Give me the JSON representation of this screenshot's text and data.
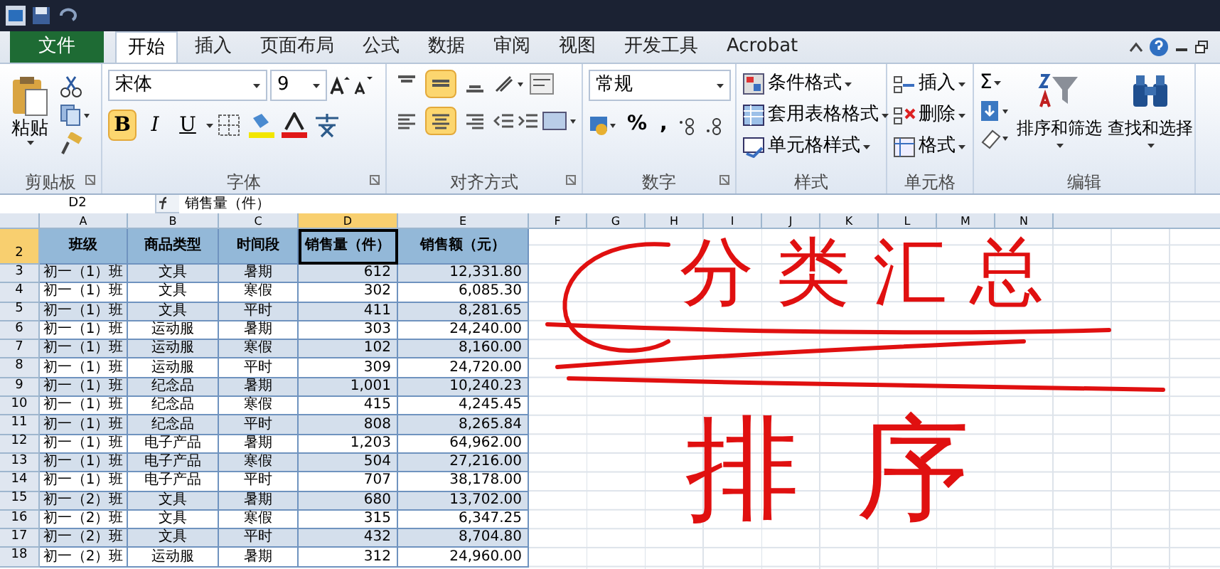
{
  "tabs": [
    {
      "label": "文件",
      "kind": "file",
      "selected": false
    },
    {
      "label": "开始",
      "kind": "tab",
      "selected": true
    },
    {
      "label": "插入",
      "kind": "tab",
      "selected": false
    },
    {
      "label": "页面布局",
      "kind": "tab",
      "selected": false
    },
    {
      "label": "公式",
      "kind": "tab",
      "selected": false
    },
    {
      "label": "数据",
      "kind": "tab",
      "selected": false
    },
    {
      "label": "审阅",
      "kind": "tab",
      "selected": false
    },
    {
      "label": "视图",
      "kind": "tab",
      "selected": false
    },
    {
      "label": "开发工具",
      "kind": "tab",
      "selected": false
    },
    {
      "label": "Acrobat",
      "kind": "tab",
      "selected": false
    }
  ],
  "ribbon": {
    "clipboard": {
      "label": "剪贴板",
      "paste": "粘贴"
    },
    "font": {
      "label": "字体",
      "font_name": "宋体",
      "font_size": "9",
      "toggles": [
        {
          "label": "B",
          "selected": true
        },
        {
          "label": "I",
          "selected": false
        },
        {
          "label": "U",
          "selected": false
        }
      ]
    },
    "alignment": {
      "label": "对齐方式",
      "vertical": [
        {
          "selected": false
        },
        {
          "selected": true
        },
        {
          "selected": false
        }
      ],
      "horizontal": [
        {
          "selected": false
        },
        {
          "selected": true
        },
        {
          "selected": false
        }
      ]
    },
    "number": {
      "label": "数字",
      "format": "常规",
      "symbols": [
        "%",
        ","
      ]
    },
    "styles": {
      "label": "样式",
      "items": [
        "条件格式",
        "套用表格格式",
        "单元格样式"
      ]
    },
    "cells": {
      "label": "单元格",
      "items": [
        "插入",
        "删除",
        "格式"
      ]
    },
    "editing": {
      "label": "编辑",
      "sigma": "Σ",
      "items": [
        "排序和筛选",
        "查找和选择"
      ]
    }
  },
  "formula_bar": {
    "name_box": "D2",
    "formula": "销售量（件）"
  },
  "columns": [
    {
      "label": "A",
      "selected": false
    },
    {
      "label": "B",
      "selected": false
    },
    {
      "label": "C",
      "selected": false
    },
    {
      "label": "D",
      "selected": true
    },
    {
      "label": "E",
      "selected": false
    },
    {
      "label": "F",
      "selected": false
    },
    {
      "label": "G",
      "selected": false
    },
    {
      "label": "H",
      "selected": false
    },
    {
      "label": "I",
      "selected": false
    },
    {
      "label": "J",
      "selected": false
    },
    {
      "label": "K",
      "selected": false
    },
    {
      "label": "L",
      "selected": false
    },
    {
      "label": "M",
      "selected": false
    },
    {
      "label": "N",
      "selected": false
    }
  ],
  "rows": [
    {
      "number": "2",
      "selected": true,
      "kind": "header",
      "cells": [
        "班级",
        "商品类型",
        "时间段",
        "销售量（件）",
        "销售额（元）"
      ]
    },
    {
      "number": "3",
      "selected": false,
      "kind": "data",
      "cells": [
        "初一（1）班",
        "文具",
        "暑期",
        "612",
        "12,331.80"
      ]
    },
    {
      "number": "4",
      "selected": false,
      "kind": "data",
      "cells": [
        "初一（1）班",
        "文具",
        "寒假",
        "302",
        "6,085.30"
      ]
    },
    {
      "number": "5",
      "selected": false,
      "kind": "data",
      "cells": [
        "初一（1）班",
        "文具",
        "平时",
        "411",
        "8,281.65"
      ]
    },
    {
      "number": "6",
      "selected": false,
      "kind": "data",
      "cells": [
        "初一（1）班",
        "运动服",
        "暑期",
        "303",
        "24,240.00"
      ]
    },
    {
      "number": "7",
      "selected": false,
      "kind": "data",
      "cells": [
        "初一（1）班",
        "运动服",
        "寒假",
        "102",
        "8,160.00"
      ]
    },
    {
      "number": "8",
      "selected": false,
      "kind": "data",
      "cells": [
        "初一（1）班",
        "运动服",
        "平时",
        "309",
        "24,720.00"
      ]
    },
    {
      "number": "9",
      "selected": false,
      "kind": "data",
      "cells": [
        "初一（1）班",
        "纪念品",
        "暑期",
        "1,001",
        "10,240.23"
      ]
    },
    {
      "number": "10",
      "selected": false,
      "kind": "data",
      "cells": [
        "初一（1）班",
        "纪念品",
        "寒假",
        "415",
        "4,245.45"
      ]
    },
    {
      "number": "11",
      "selected": false,
      "kind": "data",
      "cells": [
        "初一（1）班",
        "纪念品",
        "平时",
        "808",
        "8,265.84"
      ]
    },
    {
      "number": "12",
      "selected": false,
      "kind": "data",
      "cells": [
        "初一（1）班",
        "电子产品",
        "暑期",
        "1,203",
        "64,962.00"
      ]
    },
    {
      "number": "13",
      "selected": false,
      "kind": "data",
      "cells": [
        "初一（1）班",
        "电子产品",
        "寒假",
        "504",
        "27,216.00"
      ]
    },
    {
      "number": "14",
      "selected": false,
      "kind": "data",
      "cells": [
        "初一（1）班",
        "电子产品",
        "平时",
        "707",
        "38,178.00"
      ]
    },
    {
      "number": "15",
      "selected": false,
      "kind": "data",
      "cells": [
        "初一（2）班",
        "文具",
        "暑期",
        "680",
        "13,702.00"
      ]
    },
    {
      "number": "16",
      "selected": false,
      "kind": "data",
      "cells": [
        "初一（2）班",
        "文具",
        "寒假",
        "315",
        "6,347.25"
      ]
    },
    {
      "number": "17",
      "selected": false,
      "kind": "data",
      "cells": [
        "初一（2）班",
        "文具",
        "平时",
        "432",
        "8,704.80"
      ]
    },
    {
      "number": "18",
      "selected": false,
      "kind": "data",
      "cells": [
        "初一（2）班",
        "运动服",
        "暑期",
        "312",
        "24,960.00"
      ]
    }
  ],
  "annotations": [
    {
      "text": "分类汇总"
    },
    {
      "text": "排序"
    }
  ]
}
